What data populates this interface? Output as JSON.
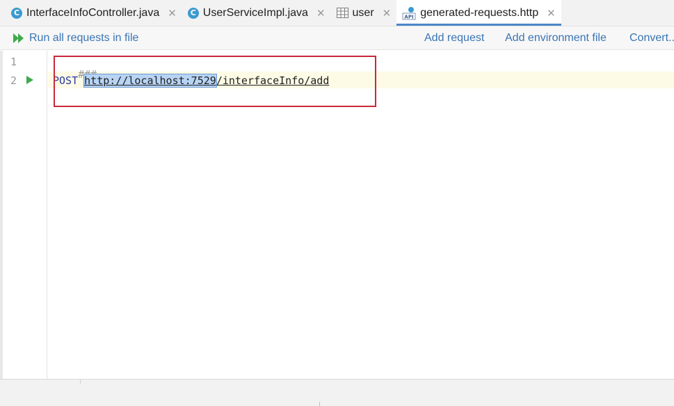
{
  "tabs": [
    {
      "label": "InterfaceInfoController.java",
      "icon": "class-icon",
      "close": "✕"
    },
    {
      "label": "UserServiceImpl.java",
      "icon": "class-icon",
      "close": "✕"
    },
    {
      "label": "user",
      "icon": "table-icon",
      "close": "✕"
    },
    {
      "label": "generated-requests.http",
      "icon": "api-icon",
      "close": "✕",
      "active": true
    }
  ],
  "toolbar": {
    "run_all_label": "Run all requests in file",
    "add_request_label": "Add request",
    "add_env_label": "Add environment file",
    "convert_label": "Convert..."
  },
  "editor": {
    "line_numbers": [
      "1",
      "2"
    ],
    "line1_comment": "###",
    "line2_method": "POST",
    "line2_url_host": "http://localhost:7529",
    "line2_url_path": "/interfaceInfo/add"
  },
  "colors": {
    "accent": "#3a74b4",
    "active_tab_underline": "#4a86c8",
    "highlight_box": "#c8283a",
    "run_green": "#3faa4a",
    "class_icon": "#3b9ad0"
  }
}
